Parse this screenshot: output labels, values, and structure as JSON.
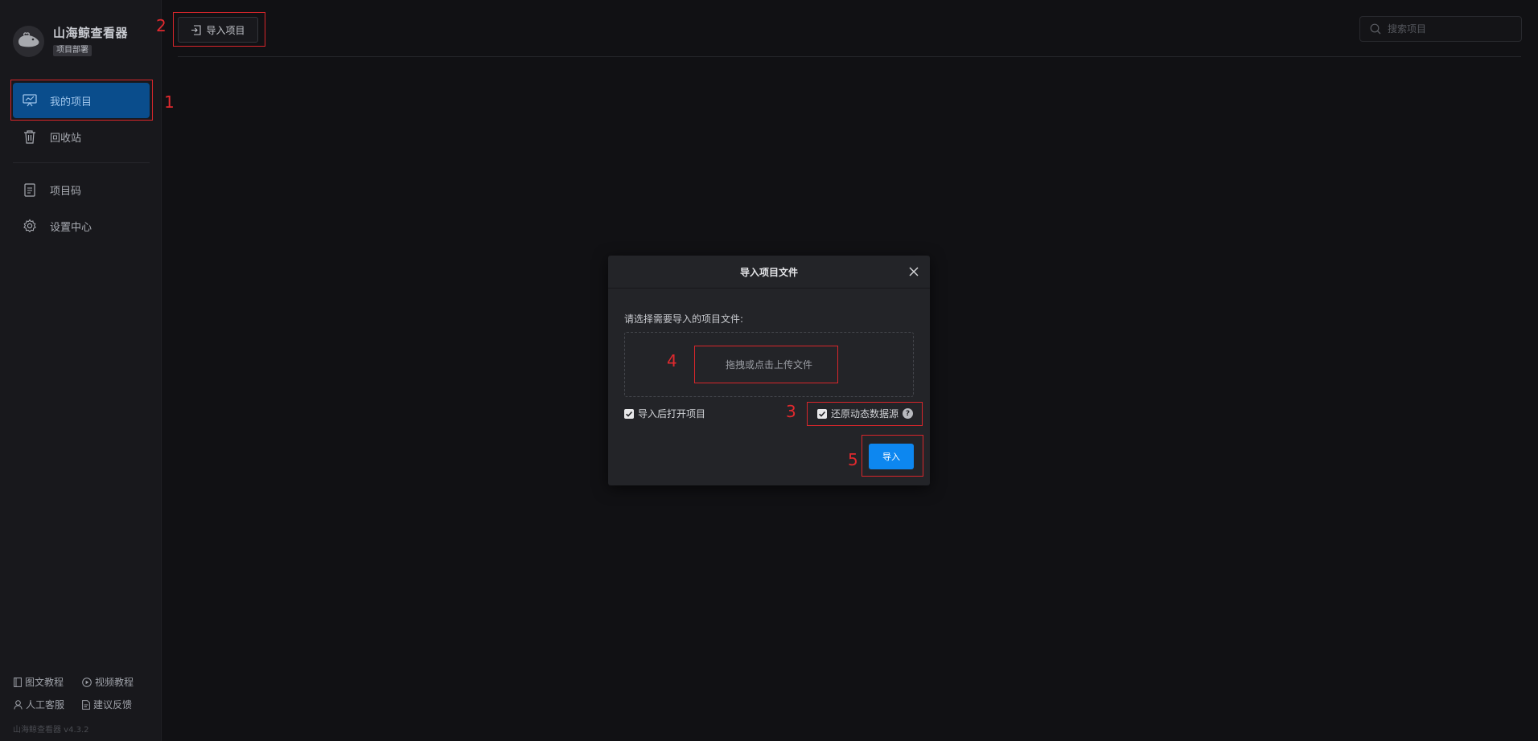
{
  "app": {
    "title": "山海鲸查看器",
    "badge": "项目部署",
    "version": "山海鲸查看器 v4.3.2"
  },
  "sidebar": {
    "items": [
      {
        "label": "我的项目",
        "icon": "presentation-board-icon",
        "active": true
      },
      {
        "label": "回收站",
        "icon": "trash-icon",
        "active": false
      },
      {
        "label": "项目码",
        "icon": "document-code-icon",
        "active": false
      },
      {
        "label": "设置中心",
        "icon": "gear-icon",
        "active": false
      }
    ],
    "footer": [
      {
        "label": "图文教程",
        "icon": "book-icon"
      },
      {
        "label": "视频教程",
        "icon": "play-circle-icon"
      },
      {
        "label": "人工客服",
        "icon": "user-icon"
      },
      {
        "label": "建议反馈",
        "icon": "feedback-doc-icon"
      }
    ]
  },
  "toolbar": {
    "import_label": "导入项目",
    "search_placeholder": "搜索项目"
  },
  "modal": {
    "title": "导入项目文件",
    "prompt": "请选择需要导入的项目文件:",
    "dropzone_text": "拖拽或点击上传文件",
    "open_after_import": {
      "label": "导入后打开项目",
      "checked": true
    },
    "restore_dynamic_source": {
      "label": "还原动态数据源",
      "checked": true
    },
    "help": "?",
    "submit_label": "导入"
  },
  "annotations": [
    "1",
    "2",
    "3",
    "4",
    "5"
  ],
  "colors": {
    "accent": "#0d87f0",
    "active_nav": "#0a4d8c",
    "annotation": "#d8262b",
    "background": "#111114",
    "sidebar": "#18181c"
  }
}
